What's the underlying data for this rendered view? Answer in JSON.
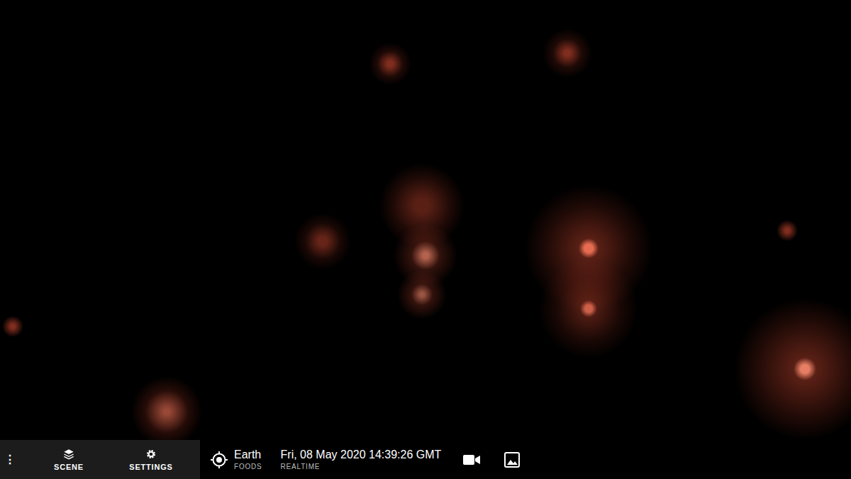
{
  "toolbar": {
    "menu": "⋮",
    "scene_button": {
      "label": "SCENE"
    },
    "settings_button": {
      "label": "SETTINGS"
    },
    "target": {
      "name": "Earth",
      "subtitle": "FOODS"
    },
    "time": {
      "value": "Fri, 08 May 2020 14:39:26 GMT",
      "mode": "REALTIME"
    }
  }
}
